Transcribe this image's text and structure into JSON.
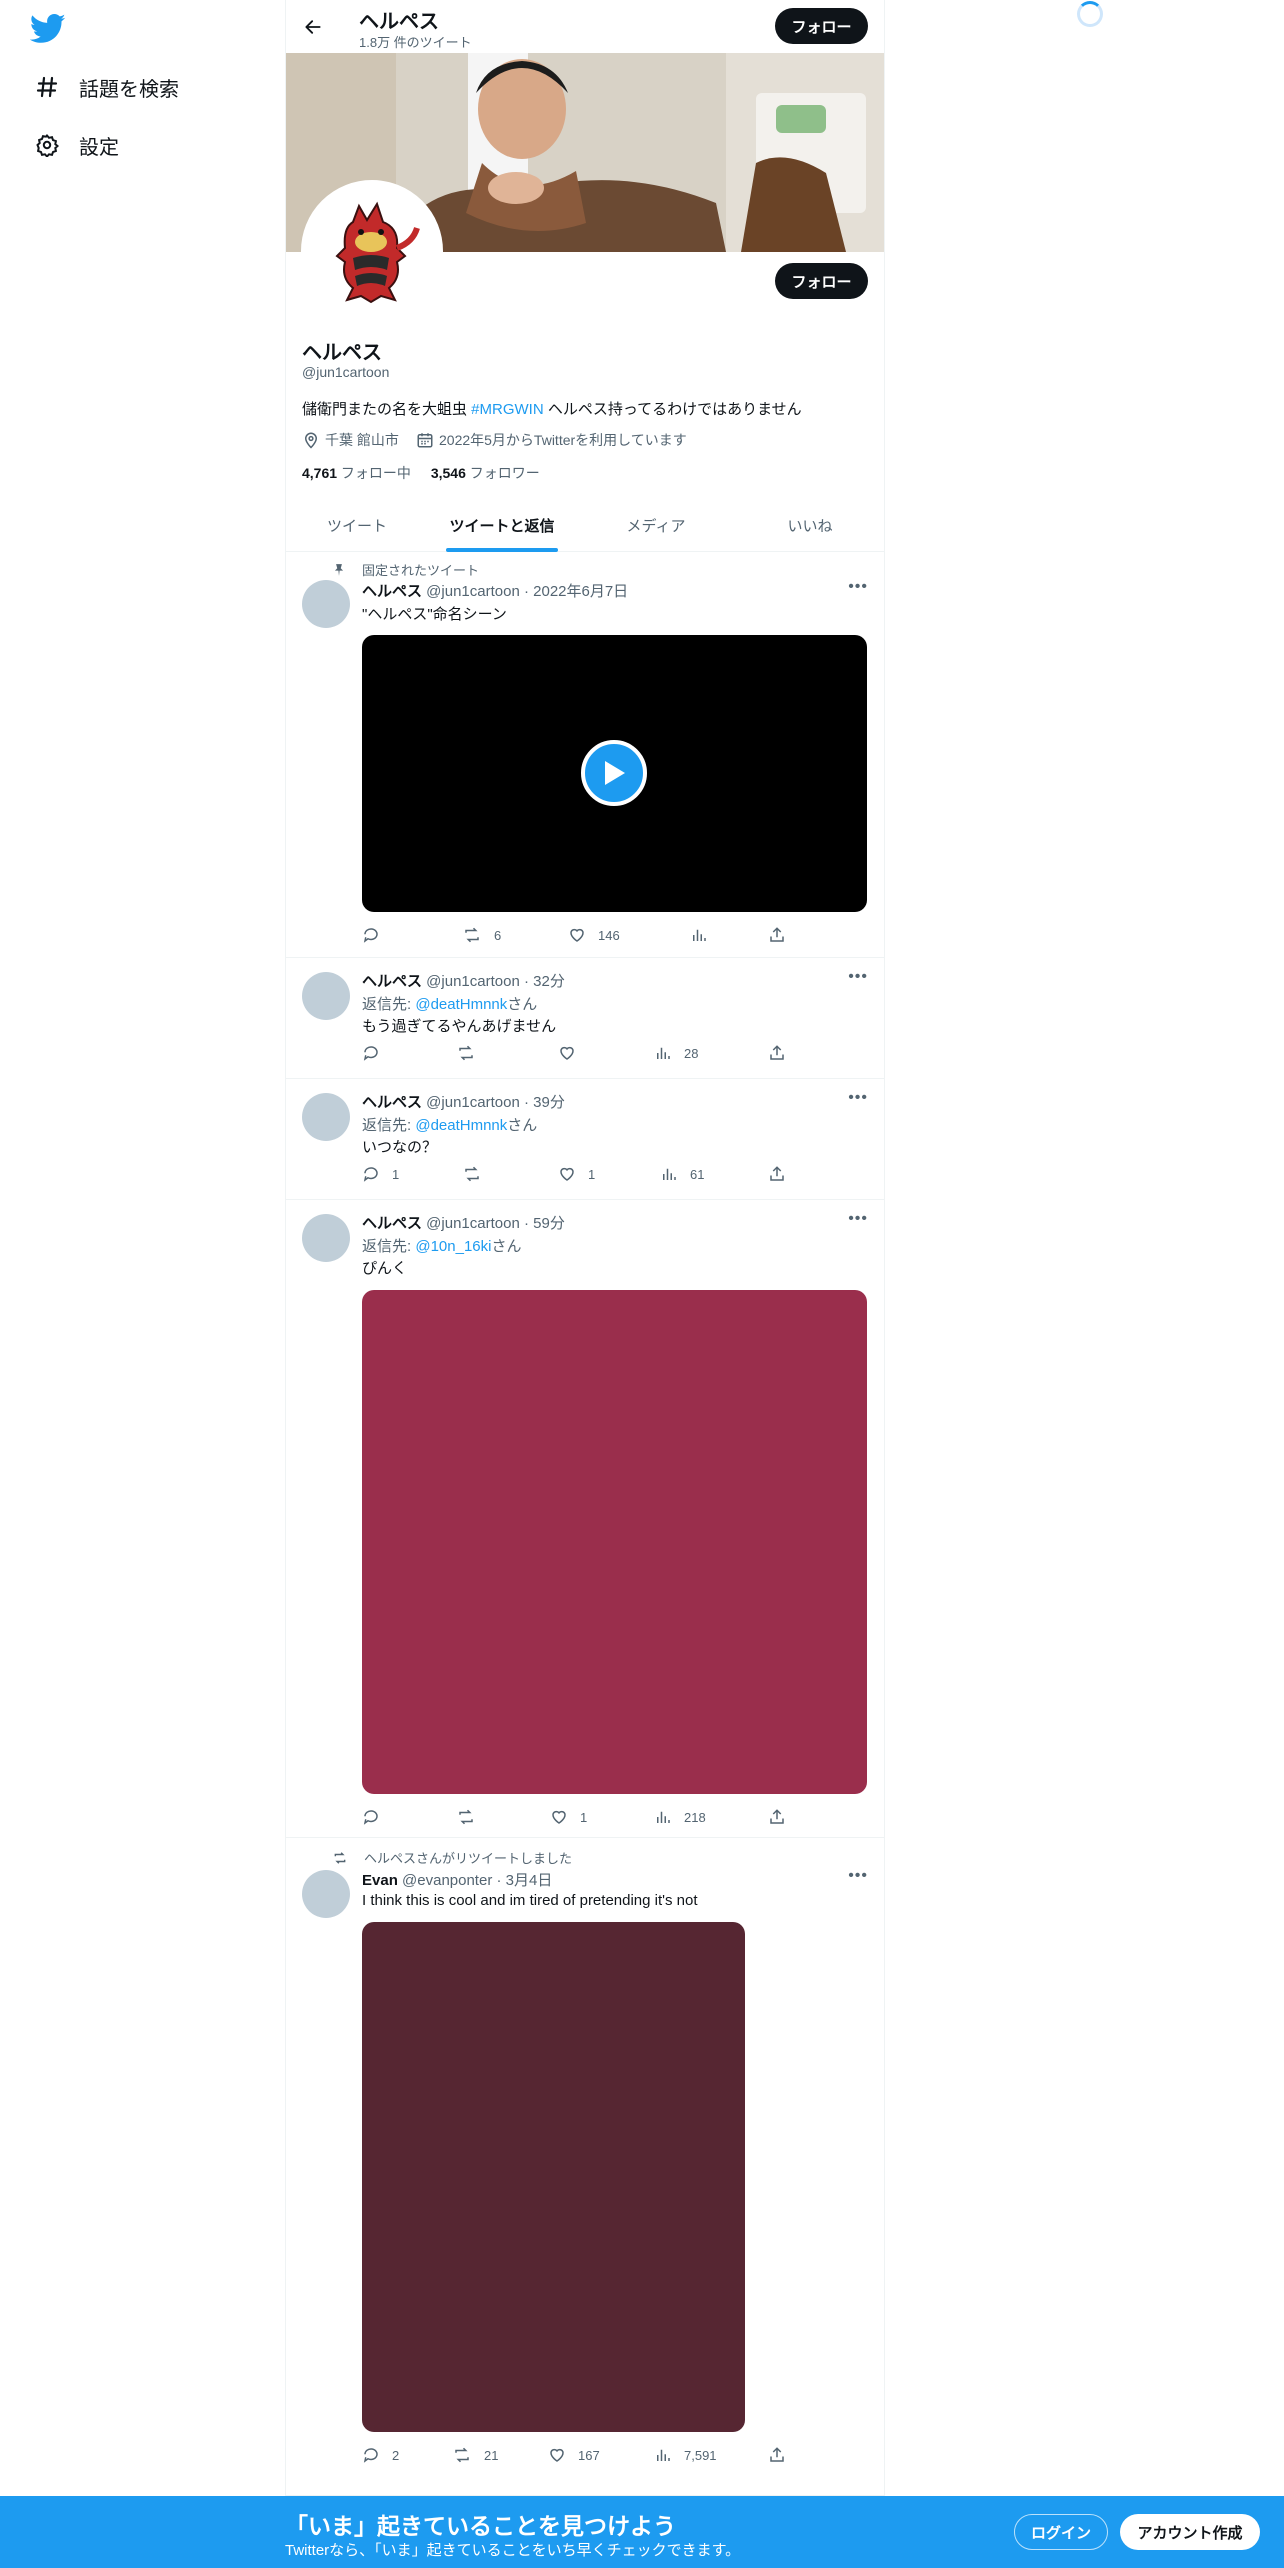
{
  "colors": {
    "accent": "#1d9bf0",
    "text": "#0f1419",
    "muted": "#536471",
    "dark_button": "#0f1419"
  },
  "nav": {
    "items": [
      {
        "label": "話題を検索",
        "icon": "hashtag-icon"
      },
      {
        "label": "設定",
        "icon": "gear-icon"
      }
    ]
  },
  "header": {
    "name": "ヘルペス",
    "tweet_count": "1.8万 件のツイート",
    "follow_label": "フォロー"
  },
  "profile": {
    "name": "ヘルペス",
    "handle": "@jun1cartoon",
    "bio_before": "儲衛門またの名を大蛆虫 ",
    "bio_hashtag": "#MRGWIN",
    "bio_after": " ヘルペス持ってるわけではありません",
    "location": "千葉 館山市",
    "joined": "2022年5月からTwitterを利用しています",
    "following_count": "4,761",
    "following_label": " フォロー中",
    "followers_count": "3,546",
    "followers_label": " フォロワー",
    "follow_label": "フォロー"
  },
  "tabs": [
    "ツイート",
    "ツイートと返信",
    "メディア",
    "いいね"
  ],
  "active_tab": "ツイートと返信",
  "tweets": [
    {
      "social": "固定されたツイート",
      "name": "ヘルペス",
      "meta": " @jun1cartoon · 2022年6月7日",
      "text": "\"ヘルペス\"命名シーン",
      "media": "video",
      "replies": "",
      "retweets": "6",
      "likes": "146",
      "views": ""
    },
    {
      "name": "ヘルペス",
      "meta": " @jun1cartoon · 32分",
      "reply_prefix": "返信先: ",
      "reply_to": "@deatHmnnk",
      "reply_suffix": "さん",
      "text": "もう過ぎてるやんあげません",
      "replies": "",
      "retweets": "",
      "likes": "",
      "views": "28"
    },
    {
      "name": "ヘルペス",
      "meta": " @jun1cartoon · 39分",
      "reply_prefix": "返信先: ",
      "reply_to": "@deatHmnnk",
      "reply_suffix": "さん",
      "text": "いつなの？",
      "replies": "1",
      "retweets": "",
      "likes": "1",
      "views": "61"
    },
    {
      "name": "ヘルペス",
      "meta": " @jun1cartoon · 59分",
      "reply_prefix": "返信先: ",
      "reply_to": "@10n_16ki",
      "reply_suffix": "さん",
      "text": "ぴんく",
      "media": "image",
      "media_color": "#9a2e4c",
      "replies": "",
      "retweets": "",
      "likes": "1",
      "views": "218"
    },
    {
      "social": "ヘルペスさんがリツイートしました",
      "name": "Evan",
      "meta": " @evanponter · 3月4日",
      "text": "I think this is cool and im tired of pretending it's not",
      "media": "image",
      "media_color": "#562632",
      "replies": "2",
      "retweets": "21",
      "likes": "167",
      "views": "7,591"
    }
  ],
  "bottom_bar": {
    "title": "「いま」起きていることを見つけよう",
    "subtitle": "Twitterなら、「いま」起きていることをいち早くチェックできます。",
    "login": "ログイン",
    "signup": "アカウント作成"
  }
}
